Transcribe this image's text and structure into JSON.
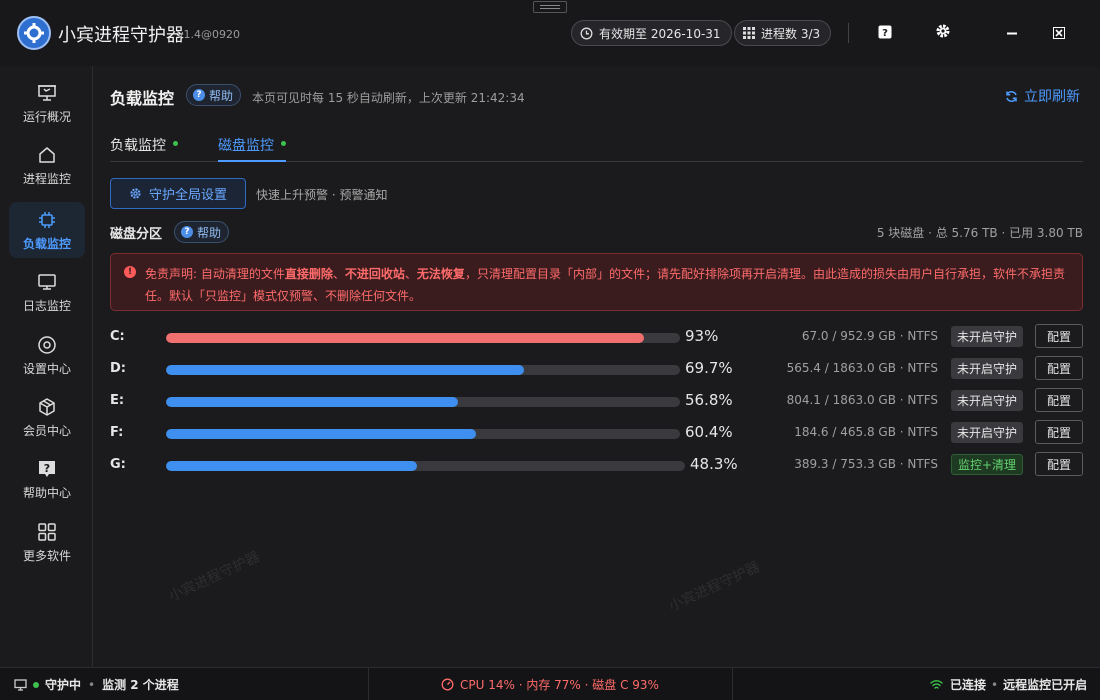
{
  "app": {
    "name": "小宾进程守护器",
    "version": "v1.4@0920",
    "validity": "有效期至 2026-10-31",
    "process_count": "进程数 3/3",
    "watermark": "小宾进程守护器"
  },
  "sidebar": {
    "items": [
      {
        "label": "运行概况",
        "icon": "monitor-chart-icon"
      },
      {
        "label": "进程监控",
        "icon": "home-icon"
      },
      {
        "label": "负载监控",
        "icon": "cpu-chip-icon"
      },
      {
        "label": "日志监控",
        "icon": "display-icon"
      },
      {
        "label": "设置中心",
        "icon": "circle-settings-icon"
      },
      {
        "label": "会员中心",
        "icon": "cube-icon"
      },
      {
        "label": "帮助中心",
        "icon": "help-box-icon"
      },
      {
        "label": "更多软件",
        "icon": "grid-apps-icon"
      }
    ],
    "active_index": 2
  },
  "main": {
    "title": "负载监控",
    "help_label": "帮助",
    "subnote": "本页可见时每 15 秒自动刷新，上次更新 21:42:34",
    "refresh_label": "立即刷新",
    "tabs": [
      {
        "label": "负载监控",
        "active": false
      },
      {
        "label": "磁盘监控",
        "active": true
      }
    ],
    "global_settings_label": "守护全局设置",
    "global_note": "快速上升预警 · 预警通知",
    "section_title": "磁盘分区",
    "section_help": "帮助",
    "disk_summary": "5 块磁盘 · 总 5.76 TB · 已用 3.80 TB",
    "warning": {
      "p1": "免责声明: 自动清理的文件",
      "b1": "直接删除",
      "p2": "、",
      "b2": "不进回收站",
      "p3": "、",
      "b3": "无法恢复",
      "p4": "，只清理配置目录「内部」的文件；请先配好排除项再开启清理。由此造成的损失由用户自行承担，软件不承担责任。默认「只监控」模式仅预警、不删除任何文件。"
    },
    "config_label": "配置"
  },
  "disks": [
    {
      "letter": "C:",
      "percent": 93,
      "percent_label": "93%",
      "info": "67.0 / 952.9 GB · NTFS",
      "status": "未开启守护",
      "status_on": false,
      "color": "#f07070"
    },
    {
      "letter": "D:",
      "percent": 69.7,
      "percent_label": "69.7%",
      "info": "565.4 / 1863.0 GB · NTFS",
      "status": "未开启守护",
      "status_on": false,
      "color": "#3f8ff0"
    },
    {
      "letter": "E:",
      "percent": 56.8,
      "percent_label": "56.8%",
      "info": "804.1 / 1863.0 GB · NTFS",
      "status": "未开启守护",
      "status_on": false,
      "color": "#3f8ff0"
    },
    {
      "letter": "F:",
      "percent": 60.4,
      "percent_label": "60.4%",
      "info": "184.6 / 465.8 GB · NTFS",
      "status": "未开启守护",
      "status_on": false,
      "color": "#3f8ff0"
    },
    {
      "letter": "G:",
      "percent": 48.3,
      "percent_label": "48.3%",
      "info": "389.3 / 753.3 GB · NTFS",
      "status": "监控+清理",
      "status_on": true,
      "color": "#3f8ff0"
    }
  ],
  "statusbar": {
    "left_state": "守护中",
    "left_detail": "监测 2 个进程",
    "center": "CPU 14% · 内存 77% · 磁盘 C 93%",
    "right_state": "已连接",
    "right_detail": "远程监控已开启"
  },
  "colors": {
    "accent": "#4d9bff",
    "danger": "#ff6b6b",
    "ok": "#3ec24d"
  }
}
